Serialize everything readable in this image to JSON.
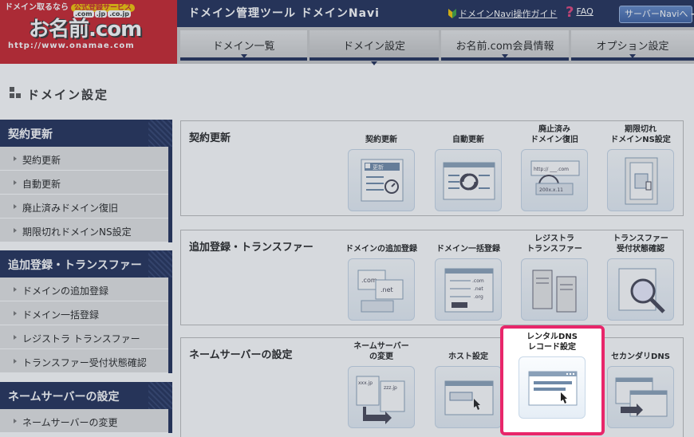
{
  "logo": {
    "line1": "ドメイン取るなら",
    "badge": "公式登録サービス",
    "tlds": [
      ".com",
      ".jp",
      ".co.jp"
    ],
    "brand": "お名前.com",
    "url": "http://www.onamae.com"
  },
  "header": {
    "tool_title": "ドメイン管理ツール ドメインNavi",
    "guide_link": "ドメインNavi操作ガイド",
    "faq_link": "FAQ",
    "server_navi_button": "サーバーNaviへ ➜"
  },
  "nav": {
    "tabs": [
      {
        "label": "ドメイン一覧"
      },
      {
        "label": "ドメイン設定"
      },
      {
        "label": "お名前.com会員情報"
      },
      {
        "label": "オプション設定"
      }
    ]
  },
  "page_title": "ドメイン設定",
  "sidebar": {
    "sections": [
      {
        "title": "契約更新",
        "items": [
          "契約更新",
          "自動更新",
          "廃止済みドメイン復旧",
          "期限切れドメインNS設定"
        ]
      },
      {
        "title": "追加登録・トランスファー",
        "items": [
          "ドメインの追加登録",
          "ドメイン一括登録",
          "レジストラ トランスファー",
          "トランスファー受付状態確認"
        ]
      },
      {
        "title": "ネームサーバーの設定",
        "items": [
          "ネームサーバーの変更"
        ]
      }
    ]
  },
  "panels": [
    {
      "title": "契約更新",
      "items": [
        "契約更新",
        "自動更新",
        "廃止済み\nドメイン復旧",
        "期限切れ\nドメインNS設定"
      ]
    },
    {
      "title": "追加登録・トランスファー",
      "items": [
        "ドメインの追加登録",
        "ドメイン一括登録",
        "レジストラ\nトランスファー",
        "トランスファー\n受付状態確認"
      ]
    },
    {
      "title": "ネームサーバーの設定",
      "items": [
        "ネームサーバー\nの変更",
        "ホスト設定",
        "レンタルDNS\nレコード設定",
        "セカンダリDNS"
      ]
    }
  ],
  "icon_text": {
    "update": "更新",
    "url": "http:// ___.com",
    "date": "200x.x.11",
    "com": ".com",
    "net": ".net",
    "list1": ".com",
    "list2": ".net",
    "list3": ".org",
    "xxx": "xxx.jp",
    "zzz": "zzz.jp"
  },
  "colors": {
    "header_navy": "#1e2c56",
    "logo_red": "#c8202a",
    "highlight_pink": "#e8266a",
    "sidebar_gray": "#e3e3e3"
  }
}
